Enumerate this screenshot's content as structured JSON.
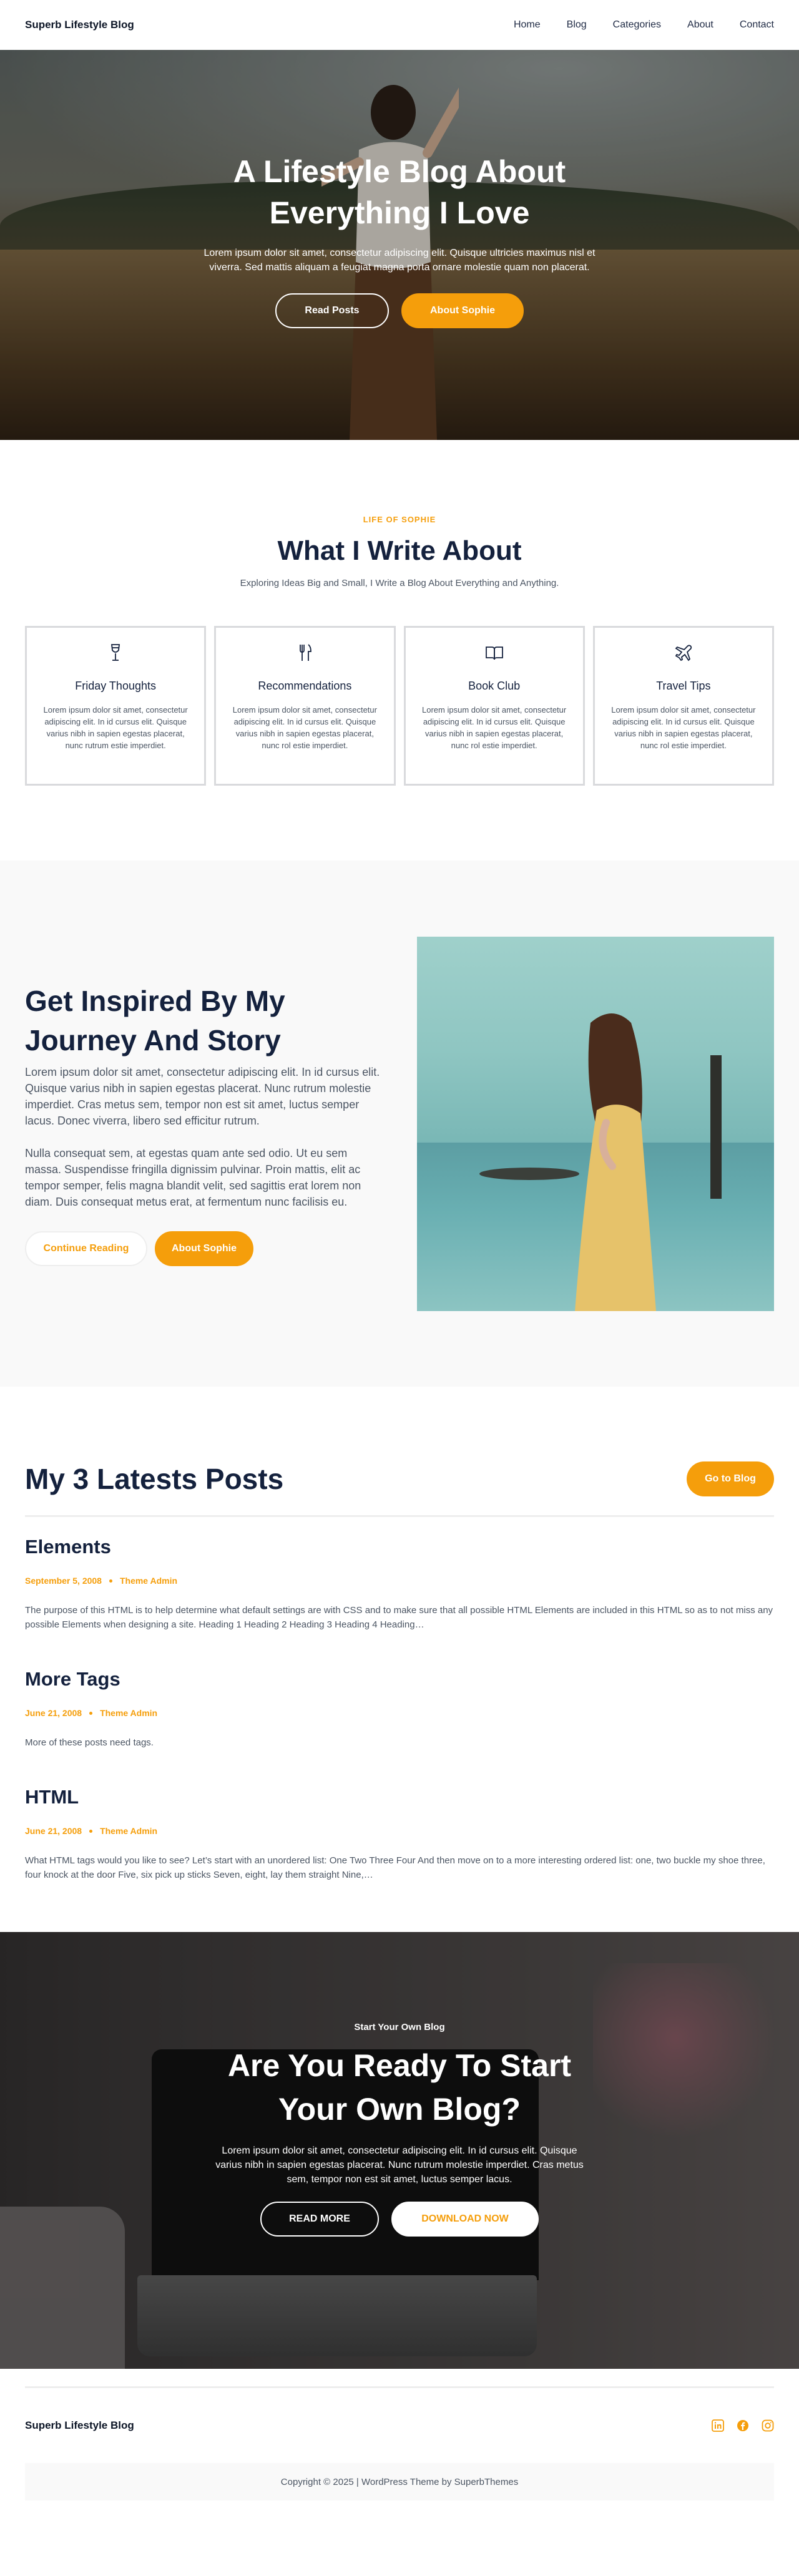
{
  "site": {
    "brand": "Superb Lifestyle Blog",
    "menu": [
      "Home",
      "Blog",
      "Categories",
      "About",
      "Contact"
    ],
    "accent_color": "#f59e0b",
    "heading_color": "#14213d"
  },
  "hero": {
    "title": "A Lifestyle Blog About Everything I Love",
    "text": "Lorem ipsum dolor sit amet, consectetur adipiscing elit. Quisque ultricies maximus nisl et viverra. Sed mattis aliquam a feugiat magna porta ornare molestie quam non placerat.",
    "btn_primary": "Read Posts",
    "btn_secondary": "About Sophie"
  },
  "about": {
    "eyebrow": "LIFE OF SOPHIE",
    "title": "What I Write About",
    "subtitle": "Exploring Ideas Big and Small, I Write a Blog About Everything and Anything.",
    "cards": [
      {
        "icon": "wine-glass-icon",
        "title": "Friday Thoughts",
        "text": "Lorem ipsum dolor sit amet, consectetur adipiscing elit. In id cursus elit. Quisque varius nibh in sapien egestas placerat, nunc rutrum estie imperdiet."
      },
      {
        "icon": "utensils-icon",
        "title": "Recommendations",
        "text": "Lorem ipsum dolor sit amet, consectetur adipiscing elit. In id cursus elit. Quisque varius nibh in sapien egestas placerat, nunc rol estie imperdiet."
      },
      {
        "icon": "book-icon",
        "title": "Book Club",
        "text": "Lorem ipsum dolor sit amet, consectetur adipiscing elit. In id cursus elit. Quisque varius nibh in sapien egestas placerat, nunc rol estie imperdiet."
      },
      {
        "icon": "plane-icon",
        "title": "Travel Tips",
        "text": "Lorem ipsum dolor sit amet, consectetur adipiscing elit. In id cursus elit. Quisque varius nibh in sapien egestas placerat, nunc rol estie imperdiet."
      }
    ]
  },
  "inspire": {
    "title": "Get Inspired By My Journey And Story",
    "para1": "Lorem ipsum dolor sit amet, consectetur adipiscing elit. In id cursus elit. Quisque varius nibh in sapien egestas placerat. Nunc rutrum molestie imperdiet. Cras metus sem, tempor non est sit amet, luctus semper lacus. Donec viverra, libero sed efficitur rutrum.",
    "para2": "Nulla consequat sem, at egestas quam ante sed odio. Ut eu sem massa. Suspendisse fringilla dignissim pulvinar. Proin mattis, elit ac tempor semper, felis magna blandit velit, sed sagittis erat lorem non diam. Duis consequat metus erat, at fermentum nunc facilisis eu.",
    "btn_primary": "Continue Reading",
    "btn_secondary": "About Sophie"
  },
  "posts": {
    "title": "My 3 Latests Posts",
    "btn": "Go to Blog",
    "items": [
      {
        "title": "Elements",
        "date": "September 5, 2008",
        "author": "Theme Admin",
        "excerpt": "The purpose of this HTML is to help determine what default settings are with CSS and to make sure that all possible HTML Elements are included in this HTML so as to not miss any possible Elements when designing a site. Heading 1 Heading 2 Heading 3 Heading 4 Heading…"
      },
      {
        "title": "More Tags",
        "date": "June 21, 2008",
        "author": "Theme Admin",
        "excerpt": "More of these posts need tags."
      },
      {
        "title": "HTML",
        "date": "June 21, 2008",
        "author": "Theme Admin",
        "excerpt": "What HTML tags would you like to see? Let’s start with an unordered list: One Two Three Four And then move on to a more interesting ordered list: one, two buckle my shoe three, four knock at the door Five, six pick up sticks Seven, eight, lay them straight Nine,…"
      }
    ]
  },
  "cta": {
    "eyebrow": "Start Your Own Blog",
    "title": "Are You Ready To Start Your Own Blog?",
    "text": "Lorem ipsum dolor sit amet, consectetur adipiscing elit. In id cursus elit. Quisque varius nibh in sapien egestas placerat. Nunc rutrum molestie imperdiet. Cras metus sem, tempor non est sit amet, luctus semper lacus.",
    "btn_primary": "READ MORE",
    "btn_secondary": "DOWNLOAD NOW"
  },
  "footer": {
    "brand": "Superb Lifestyle Blog",
    "socials": [
      "linkedin-icon",
      "facebook-icon",
      "instagram-icon"
    ],
    "copyright": "Copyright © 2025 | WordPress Theme by SuperbThemes"
  }
}
